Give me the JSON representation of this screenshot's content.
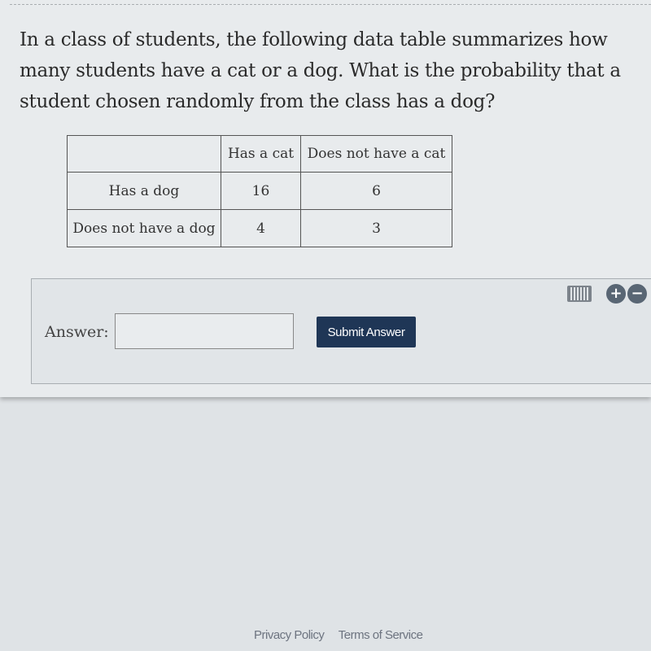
{
  "question": {
    "text": "In a class of students, the following data table summarizes how many students have a cat or a dog. What is the probability that a student chosen randomly from the class has a dog?"
  },
  "table": {
    "headers": [
      "",
      "Has a cat",
      "Does not have a cat"
    ],
    "rows": [
      {
        "label": "Has a dog",
        "values": [
          "16",
          "6"
        ]
      },
      {
        "label": "Does not have a dog",
        "values": [
          "4",
          "3"
        ]
      }
    ]
  },
  "answer": {
    "label": "Answer:",
    "value": "",
    "placeholder": "",
    "submit_label": "Submit Answer",
    "icons": [
      "keyboard-icon",
      "zoom-in-icon",
      "zoom-out-icon"
    ],
    "plus_glyph": "+",
    "minus_glyph": "−"
  },
  "footer": {
    "links": [
      "Privacy Policy",
      "Terms of Service"
    ]
  },
  "colors": {
    "submit_bg": "#1f3656",
    "icon_gray": "#596674"
  }
}
